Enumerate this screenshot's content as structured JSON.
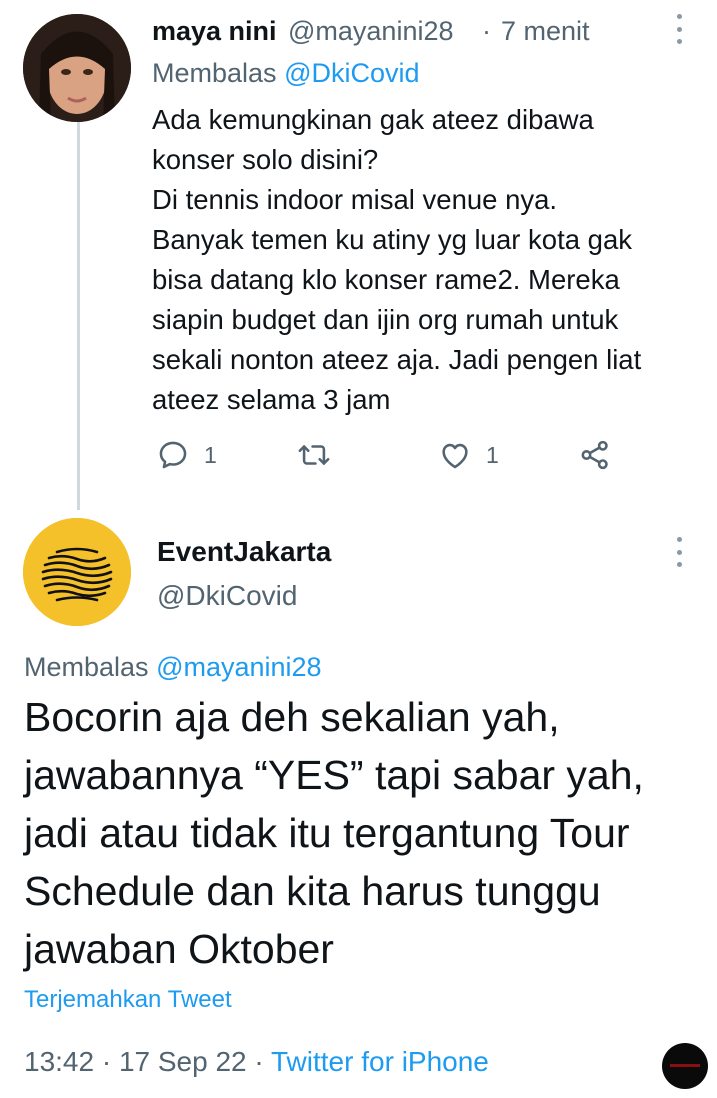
{
  "reply_tweet": {
    "display_name": "maya nini",
    "handle": "@mayanini28",
    "separator": "·",
    "time_ago": "7 menit",
    "replying_prefix": "Membalas",
    "replying_to": "@DkiCovid",
    "text_lines": [
      "Ada kemungkinan gak ateez dibawa",
      "konser solo disini?",
      "Di tennis indoor misal venue nya.",
      "Banyak temen ku atiny yg luar kota gak",
      "bisa datang klo konser rame2. Mereka",
      "siapin budget dan ijin org rumah untuk",
      "sekali nonton ateez aja. Jadi pengen liat",
      "ateez selama 3 jam"
    ],
    "actions": {
      "reply_count": "1",
      "retweet_count": "",
      "like_count": "1"
    }
  },
  "main_tweet": {
    "display_name": "EventJakarta",
    "handle": "@DkiCovid",
    "replying_prefix": "Membalas",
    "replying_to": "@mayanini28",
    "text_lines": [
      "Bocorin aja deh sekalian yah,",
      "jawabannya “YES” tapi sabar yah,",
      "jadi atau tidak itu tergantung Tour",
      "Schedule dan kita harus tunggu",
      "jawaban Oktober"
    ],
    "translate_label": "Terjemahkan Tweet",
    "timestamp": "13:42 · 17 Sep 22 · ",
    "source": "Twitter for iPhone"
  },
  "icons": {
    "reply": "comment-bubble-icon",
    "retweet": "retweet-icon",
    "like": "heart-icon",
    "share": "share-icon",
    "more": "more-vertical-icon"
  },
  "colors": {
    "link": "#1d9bf0",
    "muted": "#536471",
    "text": "#0f1419",
    "event_avatar_bg": "#f4c12a",
    "thread_line": "#cfd9de"
  }
}
